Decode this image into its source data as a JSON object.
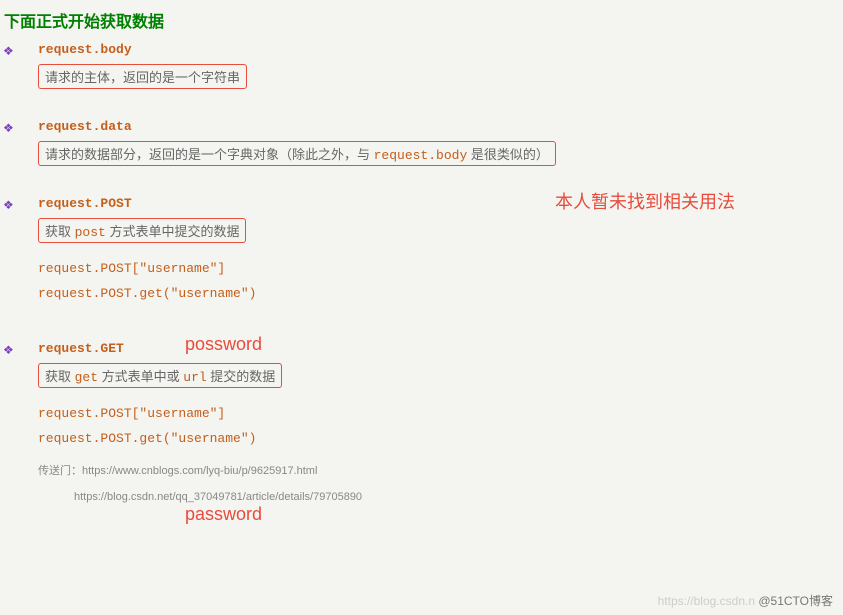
{
  "title": "下面正式开始获取数据",
  "sections": [
    {
      "heading": "request.body",
      "desc_pre": "请求的主体，返回的是一个字符串",
      "lines": []
    },
    {
      "heading": "request.data",
      "desc_pre": "请求的数据部分，返回的是一个字典对象（除此之外，与 ",
      "desc_code": "request.body",
      "desc_post": " 是很类似的）",
      "lines": []
    },
    {
      "heading": "request.POST",
      "desc_pre": "获取 ",
      "desc_code": "post",
      "desc_post": " 方式表单中提交的数据",
      "lines": [
        "request.POST[\"username\"]",
        "request.POST.get(\"username\")"
      ]
    },
    {
      "heading": "request.GET",
      "desc_pre": "获取 ",
      "desc_code": "get",
      "desc_post": " 方式表单中或 ",
      "desc_code2": "url",
      "desc_post2": " 提交的数据",
      "lines": [
        "request.POST[\"username\"]",
        "request.POST.get(\"username\")"
      ]
    }
  ],
  "annotations": {
    "a1": "本人暂未找到相关用法",
    "a2": "possword",
    "a3": "password"
  },
  "links": {
    "label": "传送门：",
    "l1": "https://www.cnblogs.com/lyq-biu/p/9625917.html",
    "l2": "https://blog.csdn.net/qq_37049781/article/details/79705890"
  },
  "watermark": {
    "light": "https://blog.csdn.n ",
    "dark": "@51CTO博客"
  }
}
